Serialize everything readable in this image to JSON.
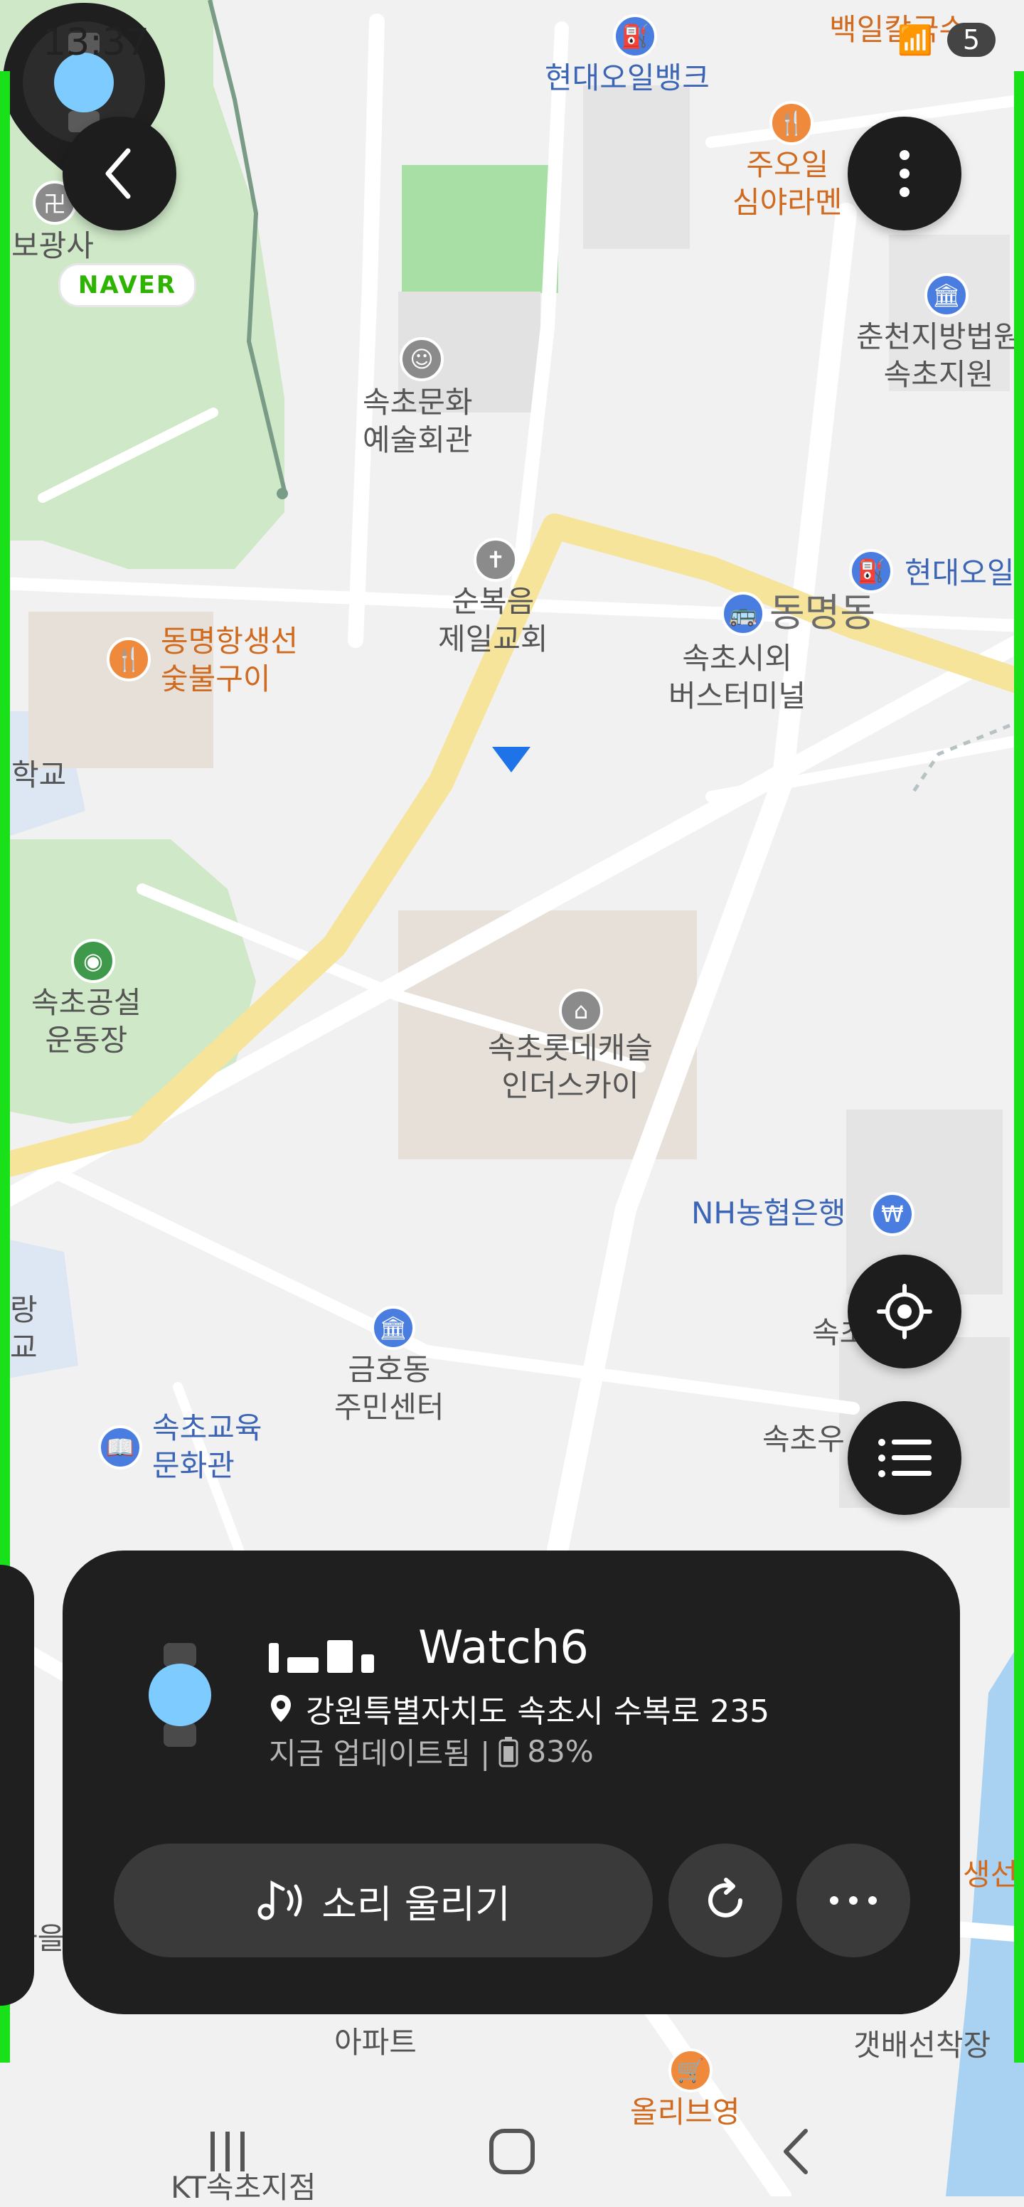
{
  "status_bar": {
    "time": "13:37",
    "signal_icons": "wifi, signal",
    "battery_level": "5"
  },
  "map": {
    "provider_logo": "NAVER",
    "pois": [
      {
        "name": "현대오일뱅크",
        "color": "blue",
        "icon": "gas-station-icon"
      },
      {
        "name": "주오일\n심야라멘",
        "color": "orange",
        "icon": "restaurant-icon"
      },
      {
        "name": "백일칼국수",
        "color": "orange",
        "icon": "restaurant-icon"
      },
      {
        "name": "보광사",
        "color": "dark",
        "icon": "temple-icon"
      },
      {
        "name": "속초문화\n예술회관",
        "color": "dark",
        "icon": "theater-icon"
      },
      {
        "name": "춘천지방법원\n속초지원",
        "color": "dark",
        "icon": "courthouse-icon"
      },
      {
        "name": "순복음\n제일교회",
        "color": "dark",
        "icon": "church-icon"
      },
      {
        "name": "현대오일",
        "color": "blue",
        "icon": "gas-station-icon"
      },
      {
        "name": "동명동",
        "color": "dark",
        "icon": ""
      },
      {
        "name": "속초시외\n버스터미널",
        "color": "dark",
        "icon": "bus-icon"
      },
      {
        "name": "동명항생선\n숯불구이",
        "color": "orange",
        "icon": "restaurant-icon"
      },
      {
        "name": "학교",
        "color": "dark",
        "icon": ""
      },
      {
        "name": "속초공설\n운동장",
        "color": "dark",
        "icon": "stadium-icon"
      },
      {
        "name": "속초롯데캐슬\n인더스카이",
        "color": "dark",
        "icon": "apartment-icon"
      },
      {
        "name": "NH농협은행",
        "color": "blue",
        "icon": "bank-icon"
      },
      {
        "name": "금호동\n주민센터",
        "color": "dark",
        "icon": "government-icon"
      },
      {
        "name": "속초교육\n문화관",
        "color": "blue",
        "icon": "library-icon"
      },
      {
        "name": "속초우",
        "color": "dark",
        "icon": ""
      },
      {
        "name": "속초",
        "color": "dark",
        "icon": ""
      },
      {
        "name": "생선",
        "color": "orange",
        "icon": ""
      },
      {
        "name": "아파트",
        "color": "dark",
        "icon": ""
      },
      {
        "name": "갯배선착장",
        "color": "dark",
        "icon": "ferry-icon"
      },
      {
        "name": "올리브영",
        "color": "orange",
        "icon": "shop-icon"
      },
      {
        "name": "KT속초지점",
        "color": "dark",
        "icon": ""
      },
      {
        "name": "랑\n교",
        "color": "dark",
        "icon": ""
      },
      {
        "name": "마을",
        "color": "dark",
        "icon": ""
      }
    ]
  },
  "device_card": {
    "device_name": "Watch6",
    "address": "강원특별자치도 속초시 수복로 235",
    "update_status": "지금 업데이트됨 |",
    "battery": "83%",
    "ring_button_label": "소리 울리기"
  },
  "colors": {
    "card_bg": "#1f1f1f",
    "button_bg": "#3a3a3a",
    "watch_face": "#7ecbff",
    "edge_highlight": "#19e019",
    "road_yellow": "#f6e49a"
  }
}
